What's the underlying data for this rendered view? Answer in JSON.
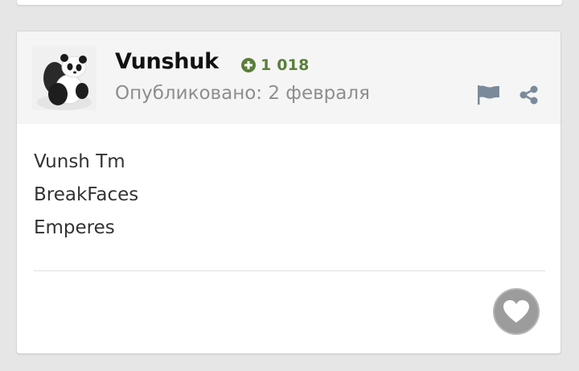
{
  "post": {
    "author": "Vunshuk",
    "reputation": "1 018",
    "published": "Опубликовано: 2 февраля",
    "lines": [
      "Vunsh Tm",
      "BreakFaces",
      "Emperes"
    ]
  },
  "icons": {
    "reputation": "plus-circle-icon",
    "report": "flag-icon",
    "share": "share-icon",
    "like": "heart-icon"
  },
  "colors": {
    "reputation": "#5a7f3a",
    "header_bg": "#f5f5f5",
    "like_button": "#9c9c9c"
  }
}
